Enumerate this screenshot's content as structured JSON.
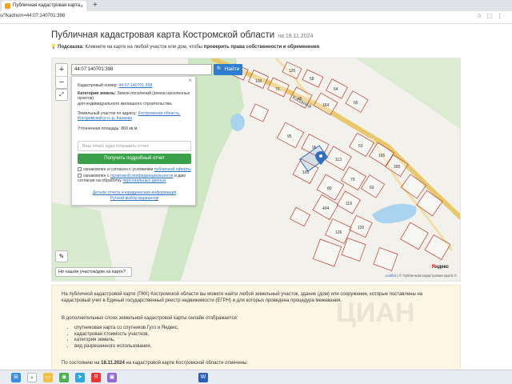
{
  "browser": {
    "tab_title": "Публичная кадастровая карта",
    "tab_close": "×",
    "new_tab": "+",
    "address": "s/?kadnum=44:07:140701:398",
    "icons": [
      "star-icon",
      "extension-icon",
      "menu-icon"
    ]
  },
  "page": {
    "title": "Публичная кадастровая карта Костромской области",
    "title_date": "на 18.11.2024",
    "hint_label": "Подсказка:",
    "hint_text": " Кликните на карте на любой участок или дом, чтобы ",
    "hint_bold": "проверить права собственности и обременения",
    "hint_end": "."
  },
  "map": {
    "zoom_in": "+",
    "zoom_out": "−",
    "expand": "⤢",
    "ruler": "✎",
    "not_found_label": "Не нашли участок/дом на карте?",
    "search_value": "44:07:140701:398",
    "search_button": "Найти",
    "village_label": "Казанка",
    "attribution_leaflet": "Leaflet",
    "attribution_rest": " | © Публичная кадастровая карта ©",
    "yandex_logo_prefix": "Я",
    "yandex_logo_rest": "ндекс",
    "plot_numbers": [
      "97",
      "103",
      "70",
      "45",
      "164",
      "135",
      "58",
      "64",
      "65",
      "95",
      "96",
      "113",
      "53",
      "165",
      "105",
      "80",
      "79",
      "60",
      "395",
      "404",
      "119",
      "126",
      "120"
    ],
    "colors": {
      "road": "#e9c86b",
      "parcel_border": "#c0392b",
      "forest": "#cfe7c4",
      "water": "#a9d3ee",
      "marker": "#2f6fbf"
    }
  },
  "popup": {
    "close": "×",
    "cadastral_label": "Кадастровый номер:",
    "cadastral_value": "44:07:140701:398",
    "category_label": "Категория земель:",
    "category_value": "Земли поселений (земли населенных пунктов)",
    "usage_value": "для индивидуального жилищного строительства.",
    "address_label": "Земельный участок по адресу:",
    "address_value": "Костромская область, Костромской р-н, д. Казанка",
    "area_label": "Уточненная площадь:",
    "area_value": "869 кв.м.",
    "email_placeholder": "Ваш email, куда отправить отчет",
    "get_report_button": "Получить подробный отчет",
    "agree_offer_prefix": "ознакомлен и согласен с условиями ",
    "agree_offer_link": "публичной оферты",
    "agree_privacy_prefix": "ознакомлен с ",
    "agree_privacy_link": "политикой конфиденциальности",
    "agree_privacy_mid": " и даю согласие на обработку ",
    "agree_privacy_link2": "персональных данных",
    "legal_link": "Детали отчета и юридическая информация",
    "manual_link": "Ручной выбор вариантов"
  },
  "info": {
    "p1": "На публичной кадастровой карте (ПКК) Костромской области вы можете найти любой земельный участок, здание (дом) или сооружение, которые поставлены на кадастровый учет в Единый государственный реестр недвижимости (ЕГРН) и для которых проведена процедура межевания.",
    "p2": "В дополнительных слоях земельной кадастровой карты онлайн отображается:",
    "list": [
      "спутниковая карта со спутников Гугл и Яндекс,",
      "кадастровая стоимость участков,",
      "категория земель,",
      "вид разрешенного использования."
    ],
    "p3_prefix": "По состоянию на ",
    "p3_date": "18.11.2024",
    "p3_suffix": " на кадастровой карте Костромской области отмечены:",
    "watermark": "ЦИАН"
  },
  "taskbar": {
    "icons": [
      "windows-start-icon",
      "search-icon",
      "file-explorer-icon",
      "chrome-icon",
      "telegram-icon",
      "yandex-icon",
      "photos-icon",
      "word-icon"
    ]
  }
}
